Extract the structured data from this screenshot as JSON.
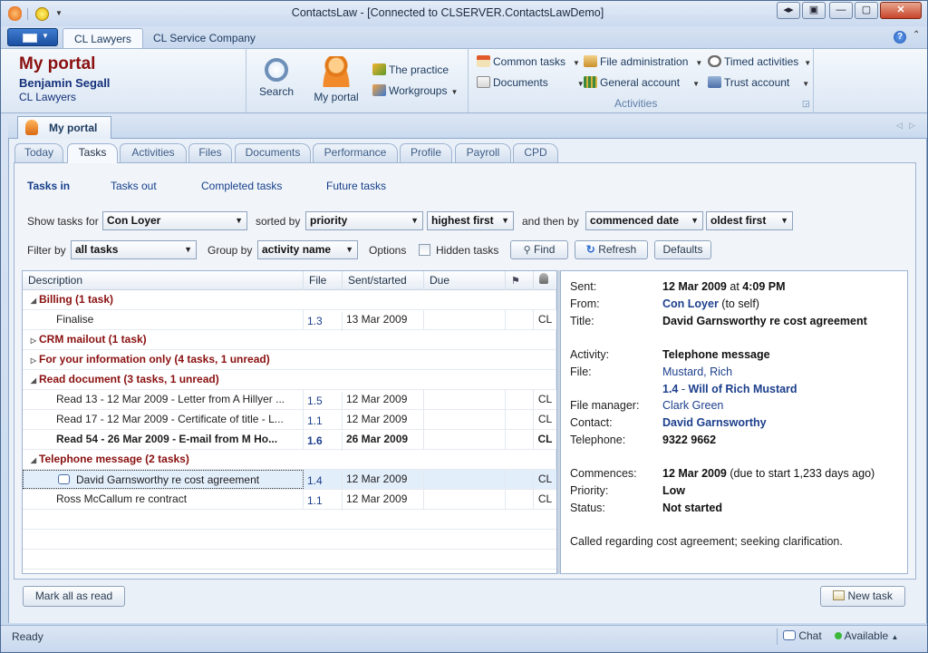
{
  "window": {
    "title": "ContactsLaw - [Connected to CLSERVER.ContactsLawDemo]"
  },
  "ribbon_tabs": [
    "CL Lawyers",
    "CL Service Company"
  ],
  "portal": {
    "title": "My portal",
    "user": "Benjamin Segall",
    "firm": "CL Lawyers"
  },
  "ribbon": {
    "search": "Search",
    "my_portal": "My portal",
    "the_practice": "The practice",
    "workgroups": "Workgroups",
    "common_tasks": "Common tasks",
    "documents": "Documents",
    "file_administration": "File administration",
    "general_account": "General account",
    "timed_activities": "Timed activities",
    "trust_account": "Trust account",
    "activities_group": "Activities"
  },
  "pane_tab": "My portal",
  "tabs": [
    "Today",
    "Tasks",
    "Activities",
    "Files",
    "Documents",
    "Performance",
    "Profile",
    "Payroll",
    "CPD"
  ],
  "subnav": [
    "Tasks in",
    "Tasks out",
    "Completed tasks",
    "Future tasks"
  ],
  "filters": {
    "show_tasks_for_label": "Show tasks for",
    "show_tasks_for": "Con Loyer",
    "sorted_by_label": "sorted by",
    "sorted_by": "priority",
    "sort_order": "highest first",
    "then_by_label": "and then by",
    "then_by": "commenced date",
    "then_order": "oldest first",
    "filter_by_label": "Filter by",
    "filter_by": "all tasks",
    "group_by_label": "Group by",
    "group_by": "activity name",
    "options_label": "Options",
    "hidden_tasks": "Hidden tasks",
    "find": "Find",
    "refresh": "Refresh",
    "defaults": "Defaults"
  },
  "grid": {
    "columns": [
      "Description",
      "File",
      "Sent/started",
      "Due"
    ],
    "groups": [
      {
        "label": "Billing (1 task)",
        "expanded": true,
        "rows": [
          {
            "desc": "Finalise",
            "file": "1.3",
            "sent": "13 Mar 2009",
            "due": "",
            "who": "CL",
            "bold": false
          }
        ]
      },
      {
        "label": "CRM mailout (1 task)",
        "expanded": false,
        "rows": []
      },
      {
        "label": "For your information only (4 tasks, 1 unread)",
        "expanded": false,
        "rows": []
      },
      {
        "label": "Read document (3 tasks, 1 unread)",
        "expanded": true,
        "rows": [
          {
            "desc": "Read 13 - 12 Mar 2009 - Letter from A Hillyer ...",
            "file": "1.5",
            "sent": "12 Mar 2009",
            "due": "",
            "who": "CL",
            "bold": false
          },
          {
            "desc": "Read 17 - 12 Mar 2009 - Certificate of title - L...",
            "file": "1.1",
            "sent": "12 Mar 2009",
            "due": "",
            "who": "CL",
            "bold": false
          },
          {
            "desc": "Read 54 - 26 Mar 2009 - E-mail from M Ho...",
            "file": "1.6",
            "sent": "26 Mar 2009",
            "due": "",
            "who": "CL",
            "bold": true
          }
        ]
      },
      {
        "label": "Telephone message (2 tasks)",
        "expanded": true,
        "rows": [
          {
            "desc": "David Garnsworthy re cost agreement",
            "file": "1.4",
            "sent": "12 Mar 2009",
            "due": "",
            "who": "CL",
            "bold": false,
            "selected": true
          },
          {
            "desc": "Ross McCallum re contract",
            "file": "1.1",
            "sent": "12 Mar 2009",
            "due": "",
            "who": "CL",
            "bold": false
          }
        ]
      }
    ]
  },
  "detail": {
    "sent_label": "Sent:",
    "sent_date": "12 Mar 2009",
    "sent_at": "at",
    "sent_time": "4:09 PM",
    "from_label": "From:",
    "from": "Con Loyer",
    "from_note": "(to self)",
    "title_label": "Title:",
    "title": "David Garnsworthy re cost agreement",
    "activity_label": "Activity:",
    "activity": "Telephone message",
    "file_label": "File:",
    "file_client": "Mustard, Rich",
    "file_number": "1.4",
    "file_sep": "-",
    "file_name": "Will of Rich Mustard",
    "manager_label": "File manager:",
    "manager": "Clark Green",
    "contact_label": "Contact:",
    "contact": "David Garnsworthy",
    "telephone_label": "Telephone:",
    "telephone": "9322 9662",
    "commences_label": "Commences:",
    "commences": "12 Mar 2009",
    "commences_note": "(due to start 1,233 days ago)",
    "priority_label": "Priority:",
    "priority": "Low",
    "status_label": "Status:",
    "status": "Not started",
    "note": "Called regarding cost agreement; seeking clarification."
  },
  "buttons": {
    "mark_all_read": "Mark all as read",
    "new_task": "New task"
  },
  "statusbar": {
    "status": "Ready",
    "chat": "Chat",
    "presence": "Available"
  }
}
